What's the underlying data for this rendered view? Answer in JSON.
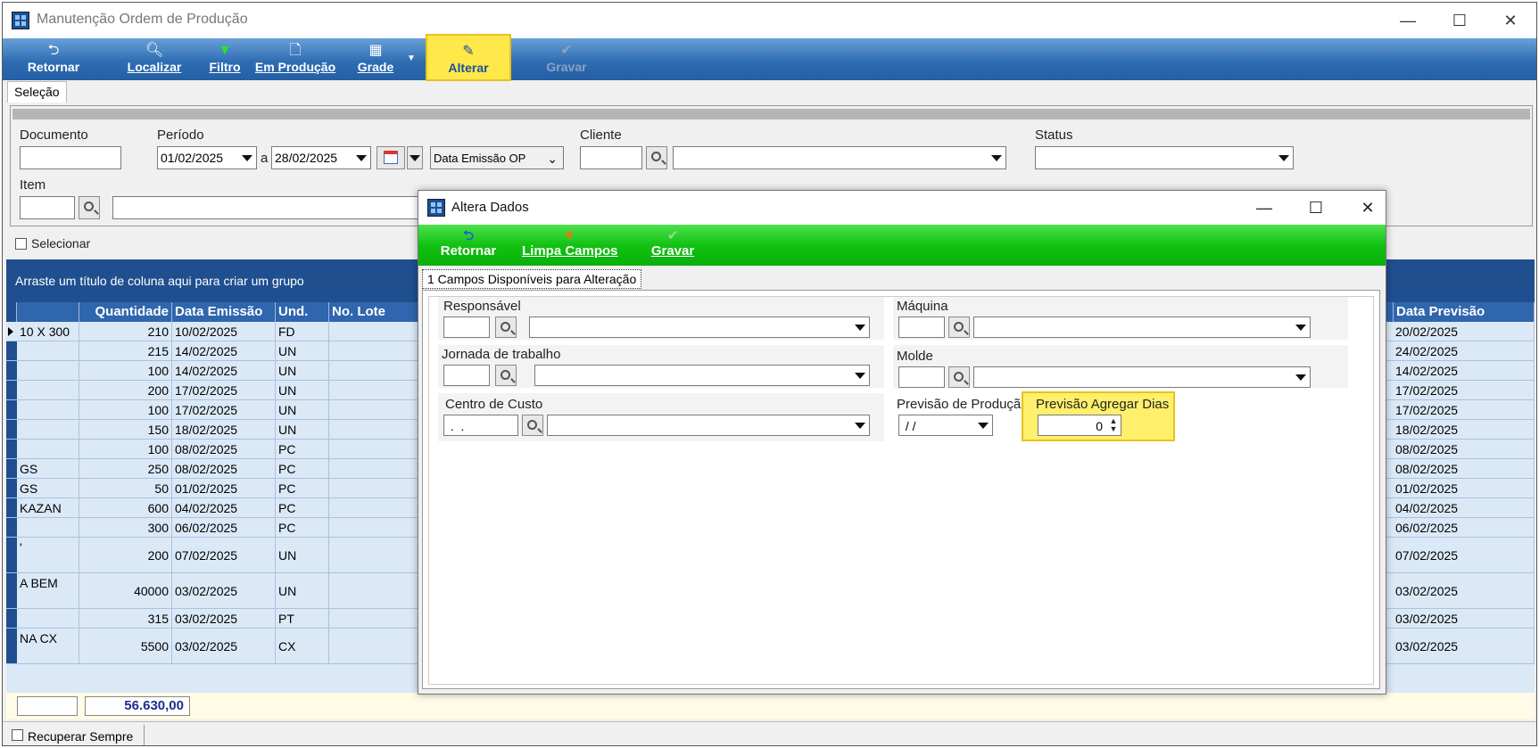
{
  "window": {
    "title": "Manutenção Ordem de Produção"
  },
  "toolbar": {
    "retornar": "Retornar",
    "localizar": "Localizar",
    "filtro": "Filtro",
    "em_producao": "Em Produção",
    "grade": "Grade",
    "alterar": "Alterar",
    "gravar": "Gravar"
  },
  "selecao": {
    "tab": "Seleção",
    "documento_label": "Documento",
    "periodo_label": "Período",
    "date_from": "01/02/2025",
    "a_label": "a",
    "date_to": "28/02/2025",
    "date_type": "Data Emissão OP",
    "cliente_label": "Cliente",
    "status_label": "Status",
    "item_label": "Item",
    "selecionar_label": "Selecionar"
  },
  "grid": {
    "group_hint": "Arraste um título de coluna aqui para criar um grupo",
    "columns": [
      "Quantidade",
      "Data Emissão",
      "Und.",
      "No. Lote",
      "Data Previsão"
    ],
    "rows": [
      {
        "desc": "10 X 300",
        "qtd": "210",
        "emissao": "10/02/2025",
        "und": "FD",
        "previsao": "20/02/2025"
      },
      {
        "desc": "",
        "qtd": "215",
        "emissao": "14/02/2025",
        "und": "UN",
        "previsao": "24/02/2025"
      },
      {
        "desc": "",
        "qtd": "100",
        "emissao": "14/02/2025",
        "und": "UN",
        "previsao": "14/02/2025"
      },
      {
        "desc": "",
        "qtd": "200",
        "emissao": "17/02/2025",
        "und": "UN",
        "previsao": "17/02/2025"
      },
      {
        "desc": "",
        "qtd": "100",
        "emissao": "17/02/2025",
        "und": "UN",
        "previsao": "17/02/2025"
      },
      {
        "desc": "",
        "qtd": "150",
        "emissao": "18/02/2025",
        "und": "UN",
        "previsao": "18/02/2025"
      },
      {
        "desc": "",
        "qtd": "100",
        "emissao": "08/02/2025",
        "und": "PC",
        "previsao": "08/02/2025"
      },
      {
        "desc": "GS",
        "qtd": "250",
        "emissao": "08/02/2025",
        "und": "PC",
        "previsao": "08/02/2025"
      },
      {
        "desc": "GS",
        "qtd": "50",
        "emissao": "01/02/2025",
        "und": "PC",
        "previsao": "01/02/2025"
      },
      {
        "desc": " KAZAN",
        "qtd": "600",
        "emissao": "04/02/2025",
        "und": "PC",
        "previsao": "04/02/2025"
      },
      {
        "desc": "",
        "qtd": "300",
        "emissao": "06/02/2025",
        "und": "PC",
        "previsao": "06/02/2025"
      },
      {
        "desc": "'",
        "qtd": "200",
        "emissao": "07/02/2025",
        "und": "UN",
        "previsao": "07/02/2025"
      },
      {
        "desc": "A BEM",
        "qtd": "40000",
        "emissao": "03/02/2025",
        "und": "UN",
        "previsao": "03/02/2025"
      },
      {
        "desc": "",
        "qtd": "315",
        "emissao": "03/02/2025",
        "und": "PT",
        "previsao": "03/02/2025"
      },
      {
        "desc": "NA CX",
        "qtd": "5500",
        "emissao": "03/02/2025",
        "und": "CX",
        "previsao": "03/02/2025"
      }
    ],
    "total": "56.630,00"
  },
  "status": {
    "recuperar": "Recuperar Sempre"
  },
  "dialog": {
    "title": "Altera Dados",
    "retornar": "Retornar",
    "limpa_campos": "Limpa Campos",
    "gravar": "Gravar",
    "tab": "1 Campos Disponíveis para Alteração",
    "responsavel": "Responsável",
    "maquina": "Máquina",
    "jornada": "Jornada de trabalho",
    "molde": "Molde",
    "centro_custo": "Centro de Custo",
    "centro_custo_value": " .  .",
    "previsao_producao": "Previsão de Produção",
    "previsao_producao_value": " / /",
    "previsao_agregar": "Previsão Agregar Dias",
    "previsao_agregar_value": "0"
  }
}
